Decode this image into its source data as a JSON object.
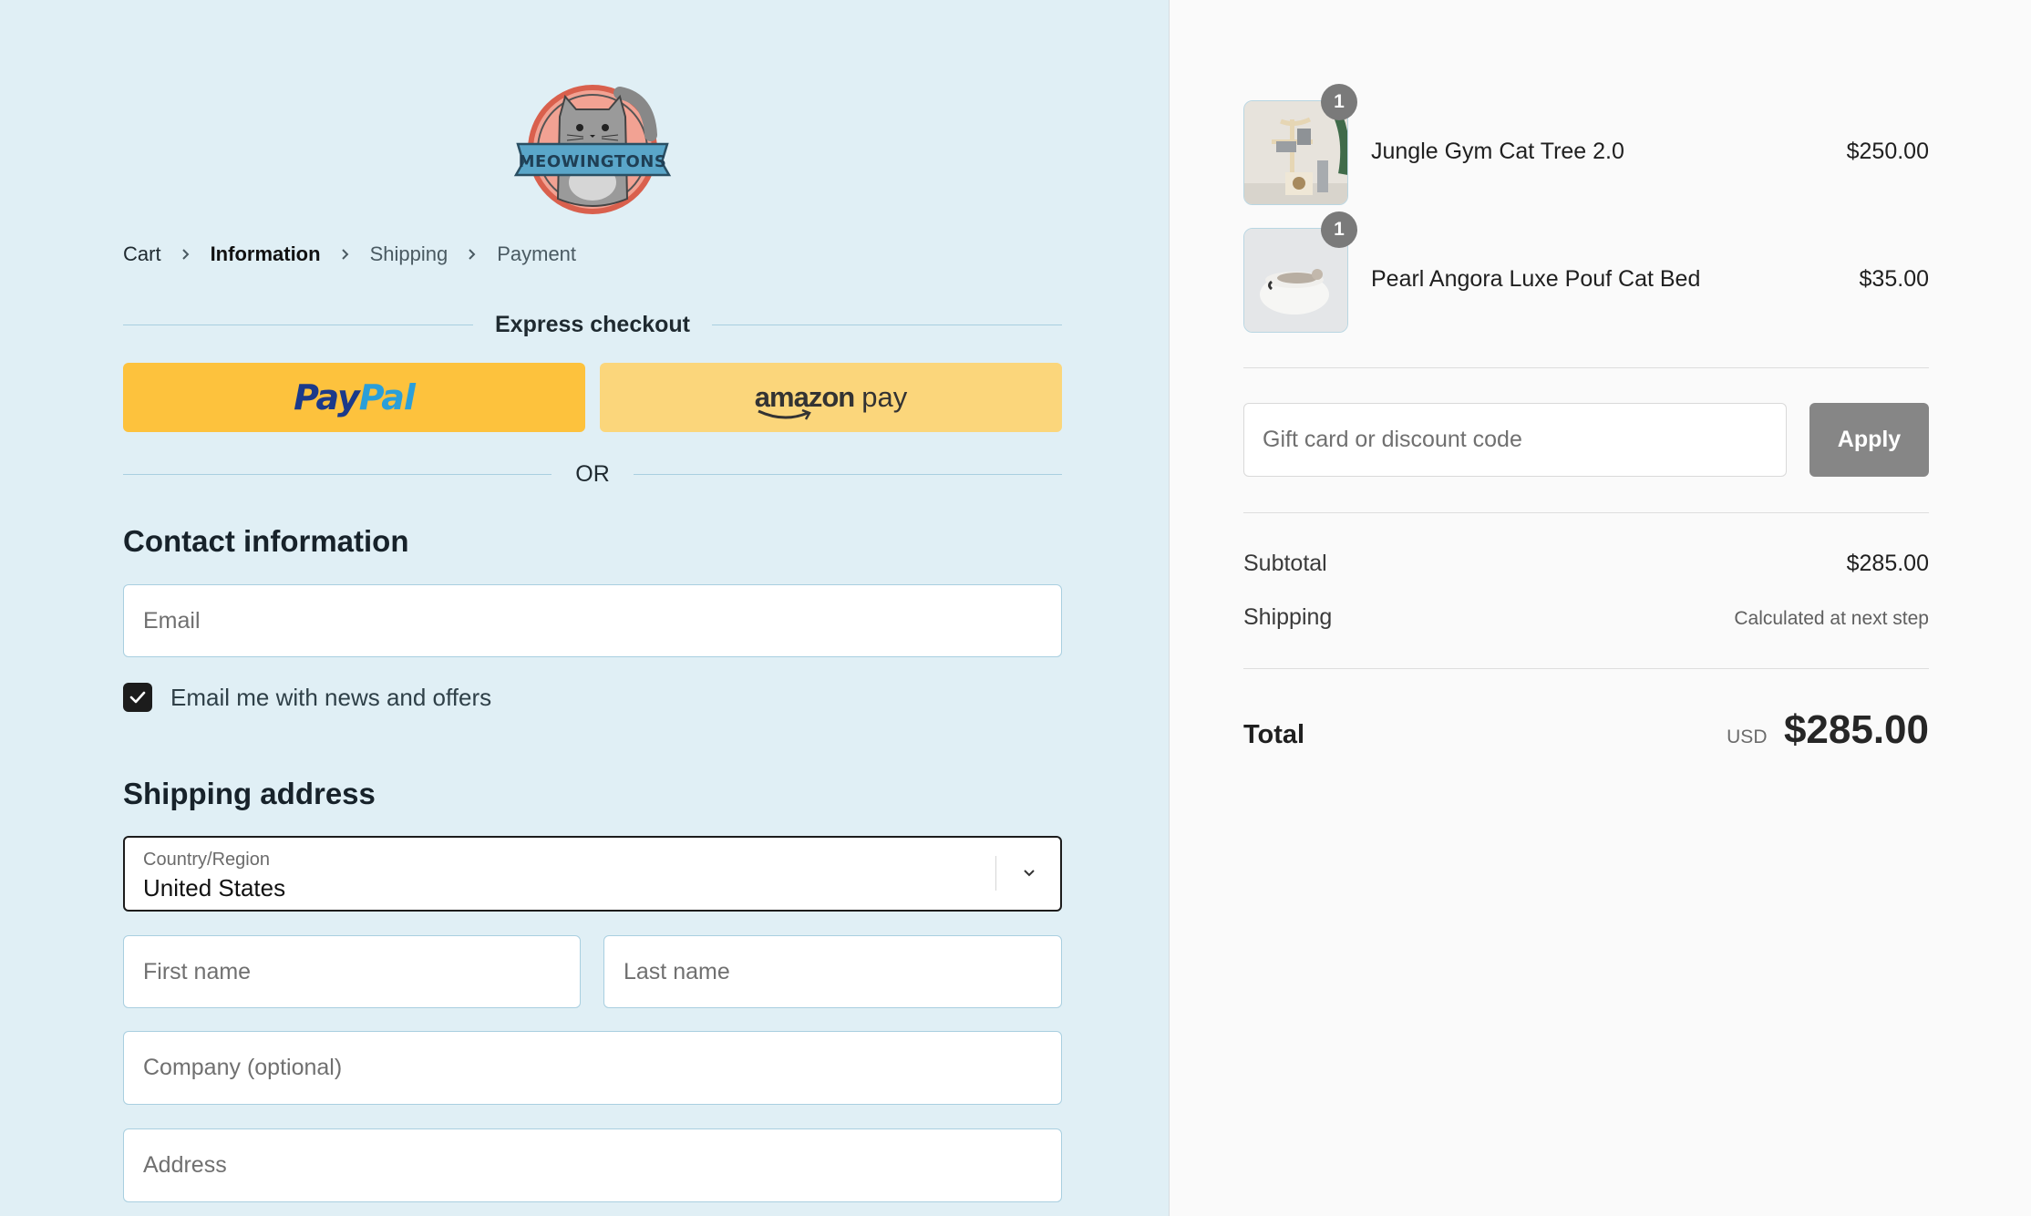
{
  "brand": {
    "name": "MEOWINGTONS",
    "logo_icon": "cat-logo-icon"
  },
  "breadcrumb": [
    {
      "label": "Cart",
      "state": "done"
    },
    {
      "label": "Information",
      "state": "current"
    },
    {
      "label": "Shipping",
      "state": "upcoming"
    },
    {
      "label": "Payment",
      "state": "upcoming"
    }
  ],
  "express": {
    "heading": "Express checkout",
    "paypal": {
      "label_part1": "Pay",
      "label_part2": "Pal",
      "bg": "#fdc23d"
    },
    "amazon": {
      "label_part1": "amazon",
      "label_part2": "pay",
      "bg": "#fbd67b"
    },
    "or_label": "OR"
  },
  "contact": {
    "title": "Contact information",
    "email_placeholder": "Email",
    "email_value": "",
    "newsletter_label": "Email me with news and offers",
    "newsletter_checked": true
  },
  "shipping": {
    "title": "Shipping address",
    "country_label": "Country/Region",
    "country_value": "United States",
    "first_name_placeholder": "First name",
    "last_name_placeholder": "Last name",
    "company_placeholder": "Company (optional)",
    "address_placeholder": "Address"
  },
  "cart": {
    "items": [
      {
        "name": "Jungle Gym Cat Tree 2.0",
        "price": "$250.00",
        "quantity": "1",
        "image": "cat-tree-image"
      },
      {
        "name": "Pearl Angora Luxe Pouf Cat Bed",
        "price": "$35.00",
        "quantity": "1",
        "image": "cat-bed-image"
      }
    ],
    "discount_placeholder": "Gift card or discount code",
    "apply_label": "Apply",
    "subtotal_label": "Subtotal",
    "subtotal_value": "$285.00",
    "shipping_label": "Shipping",
    "shipping_value": "Calculated at next step",
    "total_label": "Total",
    "total_currency": "USD",
    "total_value": "$285.00"
  },
  "colors": {
    "left_bg": "#e0eff5",
    "right_bg": "#fafafa",
    "apply_bg": "#868686",
    "checkbox_bg": "#1c1c1c"
  }
}
